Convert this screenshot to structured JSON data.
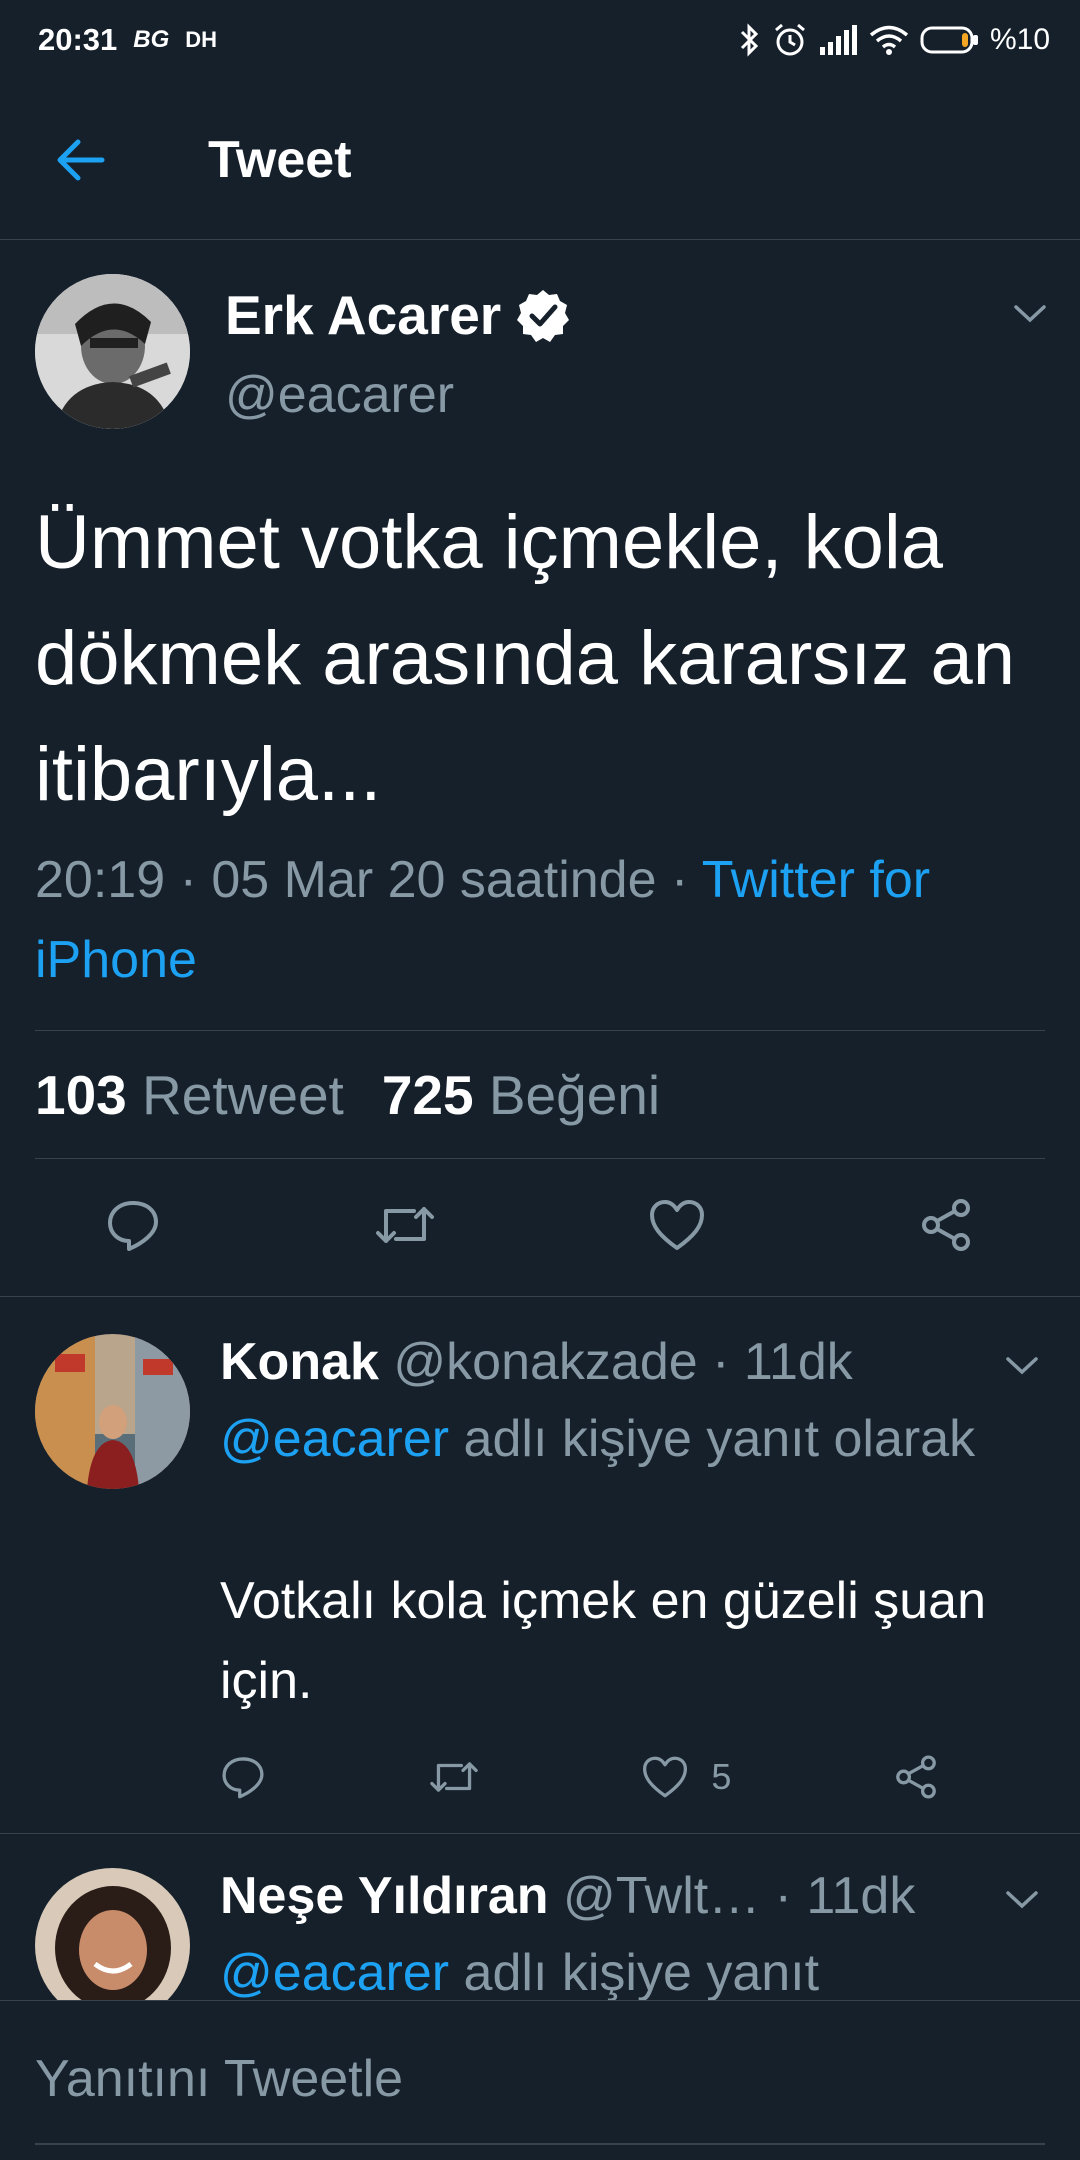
{
  "status_bar": {
    "time": "20:31",
    "indicator_1": "BG",
    "indicator_2": "DH",
    "battery": "%10",
    "icons": [
      "bluetooth-icon",
      "alarm-icon",
      "signal-icon",
      "wifi-icon",
      "battery-icon"
    ]
  },
  "app_bar": {
    "title": "Tweet"
  },
  "main_tweet": {
    "author_name": "Erk Acarer",
    "author_handle": "@eacarer",
    "text": "Ümmet votka içmekle, kola dökmek arasında kararsız an itibarıyla...",
    "time_date": "20:19 · 05 Mar 20 saatinde · ",
    "source": "Twitter for iPhone",
    "retweet_count": "103",
    "retweet_label": "Retweet",
    "like_count": "725",
    "like_label": "Beğeni"
  },
  "replies": [
    {
      "name": "Konak",
      "handle": "@konakzade",
      "time": " · 11dk",
      "reply_to": "@eacarer",
      "reply_suffix": " adlı kişiye yanıt olarak",
      "text": "Votkalı kola içmek en güzeli şuan için.",
      "like_count": "5"
    },
    {
      "name": "Neşe Yıldıran",
      "handle": "@Twlt…",
      "time": " · 11dk",
      "reply_to": "@eacarer",
      "reply_suffix": " adlı kişiye yanıt"
    }
  ],
  "compose": {
    "placeholder": "Yanıtını Tweetle"
  },
  "colors": {
    "background": "#15202b",
    "accent": "#1da1f2",
    "secondary_text": "#8899a6",
    "divider": "#38444d"
  }
}
